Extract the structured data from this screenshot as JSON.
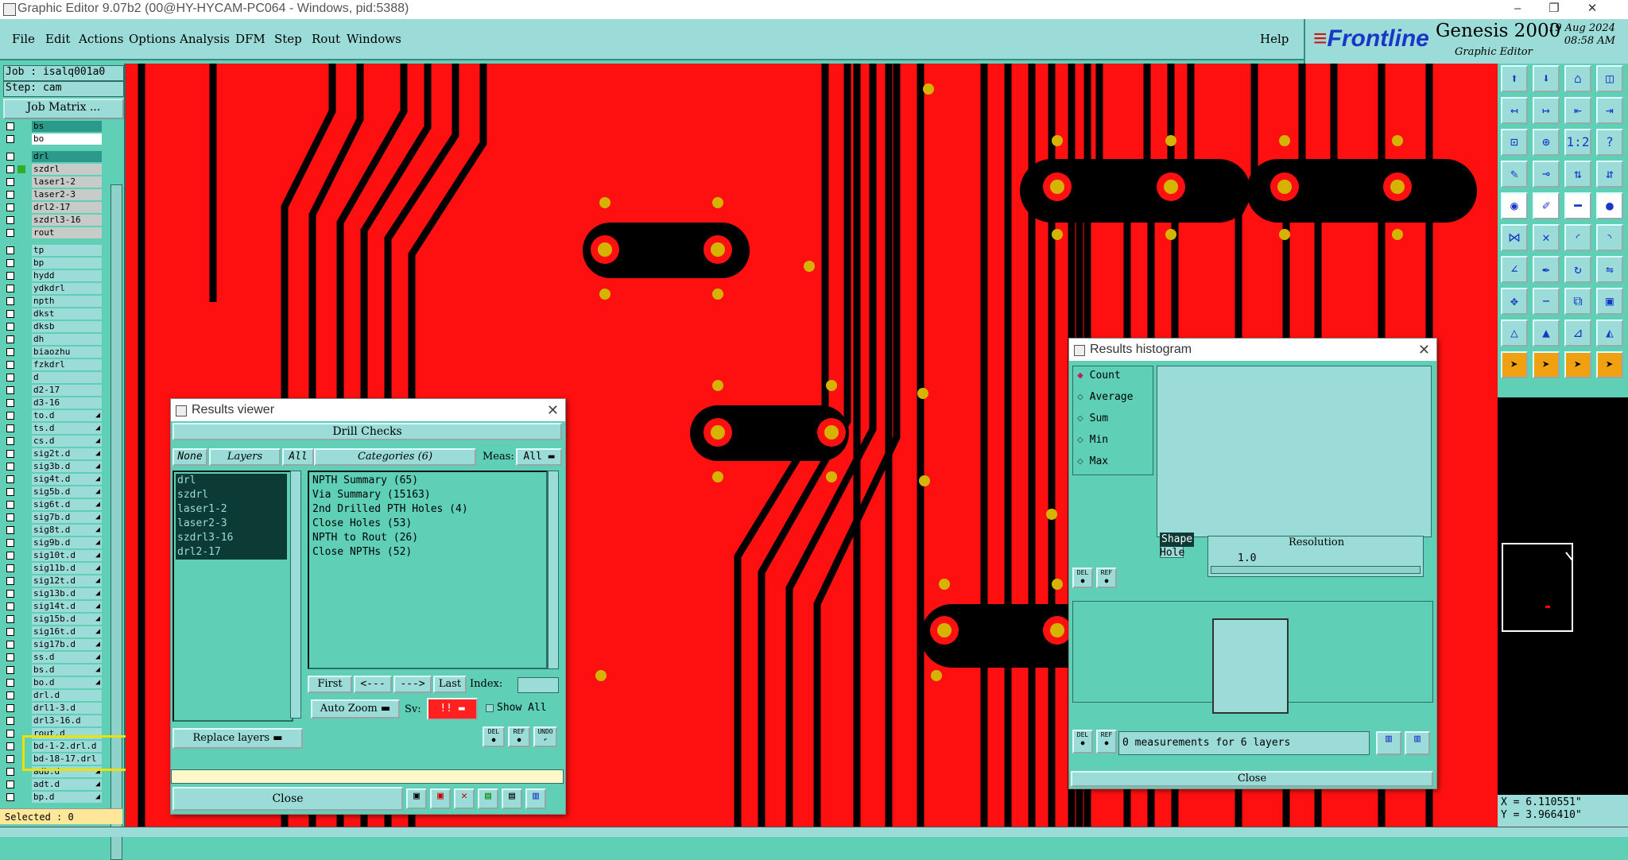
{
  "window": {
    "title": "Graphic Editor 9.07b2 (00@HY-HYCAM-PC064 - Windows, pid:5388)",
    "min_icon": "minimize-icon",
    "max_icon": "restore-icon",
    "close_icon": "close-icon"
  },
  "menu": {
    "items": [
      "File",
      "Edit",
      "Actions",
      "Options",
      "Analysis",
      "DFM",
      "Step",
      "Rout",
      "Windows"
    ],
    "help": "Help"
  },
  "brand": {
    "logo": "Frontline",
    "product": "Genesis 2000",
    "subtitle": "Graphic Editor",
    "date": "19 Aug 2024",
    "time": "08:58 AM"
  },
  "left": {
    "job": "Job : isalq001a0",
    "step": "Step: cam",
    "job_matrix": "Job Matrix ...",
    "selected": "Selected : 0",
    "layers": [
      {
        "name": "bs",
        "style": "hi"
      },
      {
        "name": "bo",
        "style": "wh"
      },
      {
        "name": "drl",
        "style": "hi"
      },
      {
        "name": "szdrl",
        "style": "gr",
        "sel": true
      },
      {
        "name": "laser1-2",
        "style": "gr"
      },
      {
        "name": "laser2-3",
        "style": "gr"
      },
      {
        "name": "drl2-17",
        "style": "gr"
      },
      {
        "name": "szdrl3-16",
        "style": "gr"
      },
      {
        "name": "rout",
        "style": "gr"
      },
      {
        "name": "tp",
        "style": ""
      },
      {
        "name": "bp",
        "style": ""
      },
      {
        "name": "hydd",
        "style": ""
      },
      {
        "name": "ydkdrl",
        "style": ""
      },
      {
        "name": "npth",
        "style": ""
      },
      {
        "name": "dkst",
        "style": ""
      },
      {
        "name": "dksb",
        "style": ""
      },
      {
        "name": "dh",
        "style": ""
      },
      {
        "name": "biaozhu",
        "style": ""
      },
      {
        "name": "fzkdrl",
        "style": ""
      },
      {
        "name": "d",
        "style": ""
      },
      {
        "name": "d2-17",
        "style": ""
      },
      {
        "name": "d3-16",
        "style": ""
      },
      {
        "name": "to.d",
        "style": "",
        "arrow": true
      },
      {
        "name": "ts.d",
        "style": "",
        "arrow": true
      },
      {
        "name": "cs.d",
        "style": "",
        "arrow": true
      },
      {
        "name": "sig2t.d",
        "style": "",
        "arrow": true
      },
      {
        "name": "sig3b.d",
        "style": "",
        "arrow": true
      },
      {
        "name": "sig4t.d",
        "style": "",
        "arrow": true
      },
      {
        "name": "sig5b.d",
        "style": "",
        "arrow": true
      },
      {
        "name": "sig6t.d",
        "style": "",
        "arrow": true
      },
      {
        "name": "sig7b.d",
        "style": "",
        "arrow": true
      },
      {
        "name": "sig8t.d",
        "style": "",
        "arrow": true
      },
      {
        "name": "sig9b.d",
        "style": "",
        "arrow": true
      },
      {
        "name": "sig10t.d",
        "style": "",
        "arrow": true
      },
      {
        "name": "sig11b.d",
        "style": "",
        "arrow": true
      },
      {
        "name": "sig12t.d",
        "style": "",
        "arrow": true
      },
      {
        "name": "sig13b.d",
        "style": "",
        "arrow": true
      },
      {
        "name": "sig14t.d",
        "style": "",
        "arrow": true
      },
      {
        "name": "sig15b.d",
        "style": "",
        "arrow": true
      },
      {
        "name": "sig16t.d",
        "style": "",
        "arrow": true
      },
      {
        "name": "sig17b.d",
        "style": "",
        "arrow": true
      },
      {
        "name": "ss.d",
        "style": "",
        "arrow": true
      },
      {
        "name": "bs.d",
        "style": "",
        "arrow": true
      },
      {
        "name": "bo.d",
        "style": "",
        "arrow": true
      },
      {
        "name": "drl.d",
        "style": ""
      },
      {
        "name": "drl1-3.d",
        "style": ""
      },
      {
        "name": "drl3-16.d",
        "style": ""
      },
      {
        "name": "rout.d",
        "style": ""
      },
      {
        "name": "bd-1-2.drl.d",
        "style": ""
      },
      {
        "name": "bd-18-17.drl",
        "style": ""
      },
      {
        "name": "adb.d",
        "style": "",
        "arrow": true
      },
      {
        "name": "adt.d",
        "style": "",
        "arrow": true
      },
      {
        "name": "bp.d",
        "style": "",
        "arrow": true
      }
    ]
  },
  "tools": {
    "icons": [
      "save-icon",
      "load-icon",
      "home-icon",
      "zoom-layout-icon",
      "undo-view-icon",
      "redo-view-icon",
      "pan-left-icon",
      "pan-right-icon",
      "fit-icon",
      "zoom-center-icon",
      "one-to-one-icon",
      "help-icon",
      "measure-icon",
      "snap-icon",
      "route-icon",
      "route2-icon",
      "circle-icon",
      "edit-icon",
      "line-icon",
      "dot-icon",
      "net-icon",
      "x-icon",
      "arc-icon",
      "arc2-icon",
      "angle-icon",
      "pen-icon",
      "rotate-icon",
      "mirror-icon",
      "move-icon",
      "minus-icon",
      "frame-icon",
      "pad-icon",
      "triangle-icon",
      "triangle2-icon",
      "triangle3-icon",
      "triangle4-icon",
      "pointer-icon",
      "pointer2-icon",
      "pointer3-icon",
      "pointer4-icon"
    ],
    "coords": {
      "x": "X = 6.110551\"",
      "y": "Y = 3.966410\""
    }
  },
  "results_viewer": {
    "title": "Results viewer",
    "header": "Drill Checks",
    "none_label": "None",
    "layers_label": "Layers",
    "all_label": "All",
    "categories_label": "Categories (6)",
    "meas_label": "Meas:",
    "meas_value": "All",
    "layers": [
      "drl",
      "szdrl",
      "laser1-2",
      "laser2-3",
      "szdrl3-16",
      "drl2-17"
    ],
    "categories": [
      "NPTH Summary (65)",
      "Via Summary (15163)",
      "2nd Drilled PTH Holes (4)",
      "Close Holes (53)",
      "NPTH to Rout (26)",
      "Close NPTHs (52)"
    ],
    "first": "First",
    "prev": "<---",
    "next": "--->",
    "last": "Last",
    "index_label": "Index:",
    "auto_zoom": "Auto Zoom",
    "sv_label": "Sv:",
    "sv_value": "!!",
    "show_all": "Show All",
    "replace_layers": "Replace layers",
    "del": "DEL",
    "ref": "REF",
    "undo": "UNDO",
    "close": "Close"
  },
  "histogram": {
    "title": "Results histogram",
    "options": [
      "Count",
      "Average",
      "Sum",
      "Min",
      "Max"
    ],
    "selected_option": "Count",
    "shape_label": "Shape",
    "hole_label": "Hole",
    "resolution_label": "Resolution",
    "resolution_value": "1.0",
    "del": "DEL",
    "ref": "REF",
    "status": "0 measurements for 6 layers",
    "close": "Close"
  },
  "colors": {
    "copper": "#ff1010",
    "pad": "#d4b400",
    "ui": "#5fd0b6",
    "ui_light": "#9cdcd8"
  }
}
